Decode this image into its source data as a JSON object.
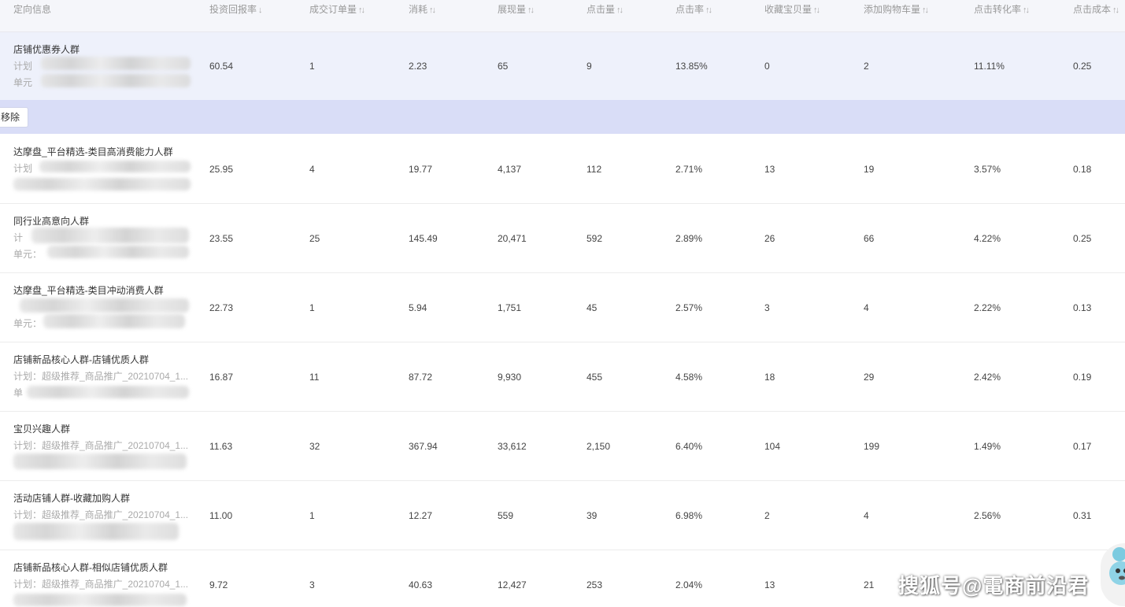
{
  "columns": [
    {
      "key": "info",
      "label": "定向信息",
      "sort": ""
    },
    {
      "key": "roi",
      "label": "投资回报率",
      "sort": "↓"
    },
    {
      "key": "orders",
      "label": "成交订单量",
      "sort": "↑↓"
    },
    {
      "key": "cost",
      "label": "消耗",
      "sort": "↑↓"
    },
    {
      "key": "impressions",
      "label": "展现量",
      "sort": "↑↓"
    },
    {
      "key": "clicks",
      "label": "点击量",
      "sort": "↑↓"
    },
    {
      "key": "ctr",
      "label": "点击率",
      "sort": "↑↓"
    },
    {
      "key": "favorites",
      "label": "收藏宝贝量",
      "sort": "↑↓"
    },
    {
      "key": "cart",
      "label": "添加购物车量",
      "sort": "↑↓"
    },
    {
      "key": "cvr",
      "label": "点击转化率",
      "sort": "↑↓"
    },
    {
      "key": "cpc",
      "label": "点击成本",
      "sort": "↑↓"
    }
  ],
  "action_bar": {
    "remove_label": "移除"
  },
  "rows": [
    {
      "name": "店铺优惠券人群",
      "plan": "计划",
      "unit": "单元",
      "roi": "60.54",
      "orders": "1",
      "cost": "2.23",
      "impressions": "65",
      "clicks": "9",
      "ctr": "13.85%",
      "favorites": "0",
      "cart": "2",
      "cvr": "11.11%",
      "cpc": "0.25"
    },
    {
      "name": "达摩盘_平台精选-类目高消费能力人群",
      "plan": "计划",
      "unit": "",
      "roi": "25.95",
      "orders": "4",
      "cost": "19.77",
      "impressions": "4,137",
      "clicks": "112",
      "ctr": "2.71%",
      "favorites": "13",
      "cart": "19",
      "cvr": "3.57%",
      "cpc": "0.18"
    },
    {
      "name": "同行业高意向人群",
      "plan": "计",
      "unit": "单元：",
      "roi": "23.55",
      "orders": "25",
      "cost": "145.49",
      "impressions": "20,471",
      "clicks": "592",
      "ctr": "2.89%",
      "favorites": "26",
      "cart": "66",
      "cvr": "4.22%",
      "cpc": "0.25"
    },
    {
      "name": "达摩盘_平台精选-类目冲动消费人群",
      "plan": "",
      "unit": "单元：",
      "roi": "22.73",
      "orders": "1",
      "cost": "5.94",
      "impressions": "1,751",
      "clicks": "45",
      "ctr": "2.57%",
      "favorites": "3",
      "cart": "4",
      "cvr": "2.22%",
      "cpc": "0.13"
    },
    {
      "name": "店铺新品核心人群-店铺优质人群",
      "plan": "计划：超级推荐_商品推广_20210704_1...",
      "unit": "单",
      "roi": "16.87",
      "orders": "11",
      "cost": "87.72",
      "impressions": "9,930",
      "clicks": "455",
      "ctr": "4.58%",
      "favorites": "18",
      "cart": "29",
      "cvr": "2.42%",
      "cpc": "0.19"
    },
    {
      "name": "宝贝兴趣人群",
      "plan": "计划：超级推荐_商品推广_20210704_1...",
      "unit": "",
      "roi": "11.63",
      "orders": "32",
      "cost": "367.94",
      "impressions": "33,612",
      "clicks": "2,150",
      "ctr": "6.40%",
      "favorites": "104",
      "cart": "199",
      "cvr": "1.49%",
      "cpc": "0.17"
    },
    {
      "name": "活动店铺人群-收藏加购人群",
      "plan": "计划：超级推荐_商品推广_20210704_1...",
      "unit": "",
      "roi": "11.00",
      "orders": "1",
      "cost": "12.27",
      "impressions": "559",
      "clicks": "39",
      "ctr": "6.98%",
      "favorites": "2",
      "cart": "4",
      "cvr": "2.56%",
      "cpc": "0.31"
    },
    {
      "name": "店铺新品核心人群-相似店铺优质人群",
      "plan": "计划：超级推荐_商品推广_20210704_1...",
      "unit": "",
      "roi": "9.72",
      "orders": "3",
      "cost": "40.63",
      "impressions": "12,427",
      "clicks": "253",
      "ctr": "2.04%",
      "favorites": "13",
      "cart": "21",
      "cvr": "",
      "cpc": ""
    }
  ],
  "watermark": "搜狐号@電商前沿君"
}
